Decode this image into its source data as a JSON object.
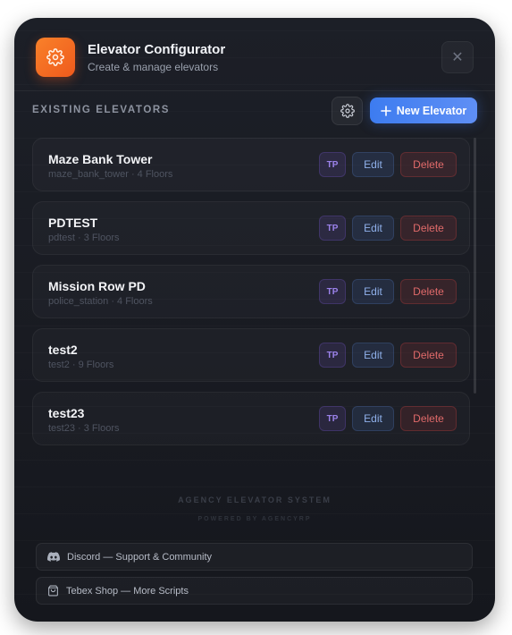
{
  "header": {
    "title": "Elevator Configurator",
    "subtitle": "Create & manage elevators",
    "close_label": "✕"
  },
  "section": {
    "title": "EXISTING ELEVATORS",
    "new_button_label": "New Elevator"
  },
  "elevators": [
    {
      "name": "Maze Bank Tower",
      "meta": "maze_bank_tower · 4 Floors"
    },
    {
      "name": "PDTEST",
      "meta": "pdtest · 3 Floors"
    },
    {
      "name": "Mission Row PD",
      "meta": "police_station · 4 Floors"
    },
    {
      "name": "test2",
      "meta": "test2 · 9 Floors"
    },
    {
      "name": "test23",
      "meta": "test23 · 3 Floors"
    }
  ],
  "row_actions": {
    "tp_label": "TP",
    "edit_label": "Edit",
    "delete_label": "Delete"
  },
  "footer": {
    "brand": "AGENCY ELEVATOR SYSTEM",
    "powered": "POWERED BY AGENCYRP",
    "discord_label": "Discord — Support & Community",
    "tebex_label": "Tebex Shop — More Scripts"
  },
  "icons": {
    "logo": "gear-icon",
    "settings": "gear-icon",
    "new": "plus-icon",
    "discord": "discord-icon",
    "tebex": "shop-bag-icon"
  },
  "colors": {
    "accent_orange": "#f9812a",
    "accent_blue": "#3d7cf0",
    "danger": "#e06a6a",
    "tp_purple": "#9b82ea"
  }
}
